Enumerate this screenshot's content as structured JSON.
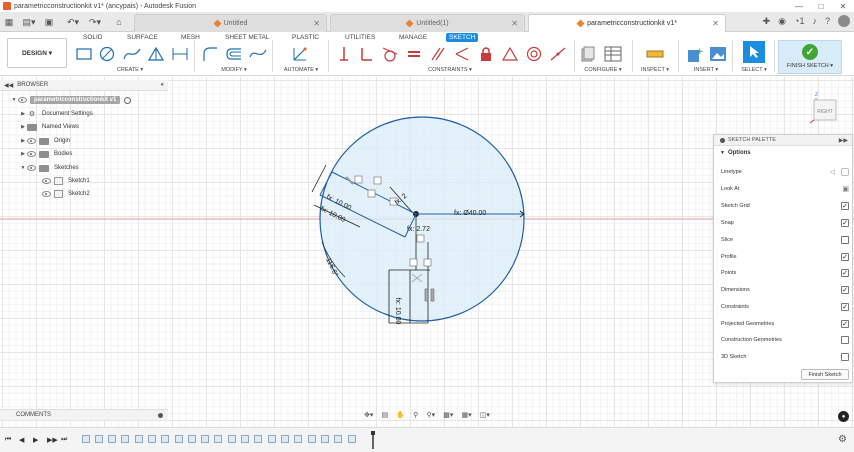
{
  "window": {
    "title": "parametricconstructionkit v1* (ancypais) - Autodesk Fusion"
  },
  "tabs": [
    {
      "label": "Untitled",
      "active": false
    },
    {
      "label": "Untitled(1)",
      "active": false
    },
    {
      "label": "parametricconstructionkit v1*",
      "active": true
    }
  ],
  "toolbar": {
    "workspace_tabs": [
      "SOLID",
      "SURFACE",
      "MESH",
      "SHEET METAL",
      "PLASTIC",
      "UTILITIES",
      "MANAGE",
      "SKETCH"
    ],
    "active_workspace_tab": "SKETCH",
    "design_label": "DESIGN",
    "groups": {
      "create": "CREATE",
      "modify": "MODIFY",
      "automate": "AUTOMATE",
      "constraints": "CONSTRAINTS",
      "configure": "CONFIGURE",
      "inspect": "INSPECT",
      "insert": "INSERT",
      "select": "SELECT",
      "finish": "FINISH SKETCH"
    },
    "accent_color": "#1b8de0"
  },
  "browser": {
    "header": "BROWSER",
    "root": "parametricconstructionkit v1",
    "items": [
      {
        "label": "Document Settings"
      },
      {
        "label": "Named Views"
      },
      {
        "label": "Origin"
      },
      {
        "label": "Bodies"
      },
      {
        "label": "Sketches"
      },
      {
        "label": "Sketch1"
      },
      {
        "label": "Sketch2"
      }
    ]
  },
  "sketch": {
    "dim_diameter": "fx: Ø40.00",
    "dim_272": "fx: 2.72",
    "dim_10a": "fx: 10.00",
    "dim_10b": "fx: 10.00",
    "dim_10c": "fx: 10.00",
    "dim_angle": "116.6°",
    "dim_small": "fx: 2"
  },
  "viewcube": {
    "face": "RIGHT",
    "axis": "Z"
  },
  "palette": {
    "title": "SKETCH PALETTE",
    "section": "Options",
    "rows": [
      {
        "label": "Linetype",
        "checked": false
      },
      {
        "label": "Look At",
        "checked": false
      },
      {
        "label": "Sketch Grid",
        "checked": true
      },
      {
        "label": "Snap",
        "checked": true
      },
      {
        "label": "Slice",
        "checked": false
      },
      {
        "label": "Profile",
        "checked": true
      },
      {
        "label": "Points",
        "checked": true
      },
      {
        "label": "Dimensions",
        "checked": true
      },
      {
        "label": "Constraints",
        "checked": true
      },
      {
        "label": "Projected Geometries",
        "checked": true
      },
      {
        "label": "Construction Geometries",
        "checked": false
      },
      {
        "label": "3D Sketch",
        "checked": false
      }
    ],
    "finish_button": "Finish Sketch"
  },
  "comments": {
    "label": "COMMENTS"
  }
}
